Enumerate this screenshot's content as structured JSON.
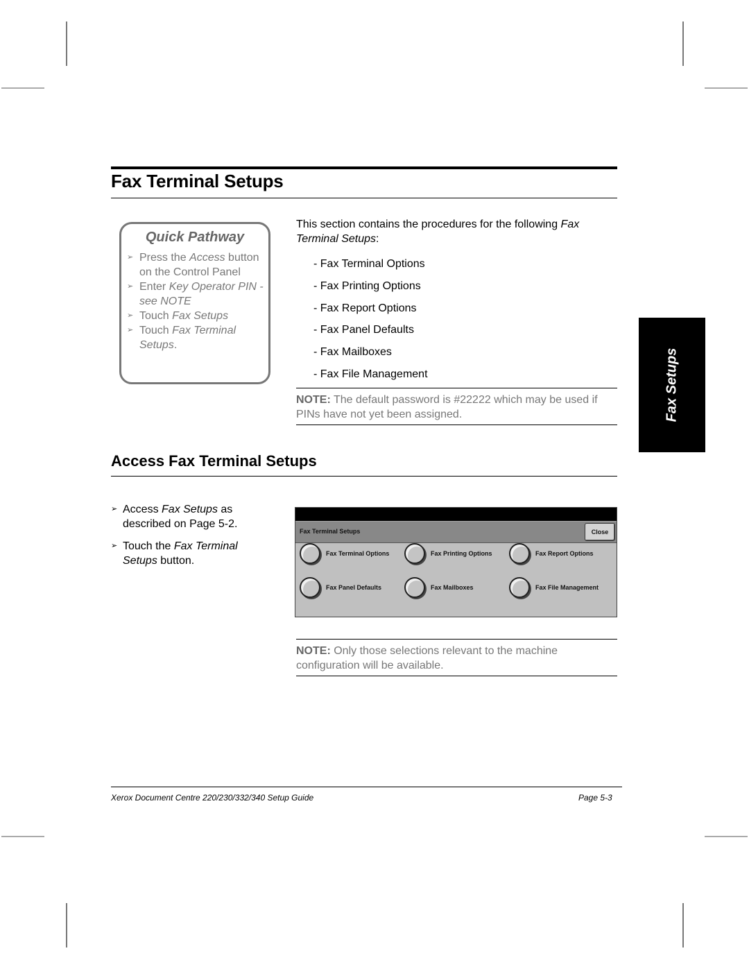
{
  "page_title": "Fax Terminal Setups",
  "quick_pathway": {
    "title": "Quick Pathway",
    "steps": [
      {
        "pre": "Press the ",
        "em": "Access",
        "post": " button on the Control Panel"
      },
      {
        "pre": "Enter ",
        "em": "Key Operator PIN - see NOTE",
        "post": ""
      },
      {
        "pre": "Touch ",
        "em": "Fax Setups",
        "post": ""
      },
      {
        "pre": "Touch ",
        "em": "Fax Terminal Setups",
        "post": "."
      }
    ],
    "bullet": "➢"
  },
  "intro": {
    "pre": "This section contains the procedures for the following ",
    "em": "Fax Terminal Setups",
    "post": ":"
  },
  "procedures": [
    "Fax Terminal Options",
    "Fax Printing Options",
    "Fax Report Options",
    "Fax Panel Defaults",
    "Fax Mailboxes",
    "Fax File Management"
  ],
  "procedure_prefix": "-",
  "note1": {
    "label": "NOTE:",
    "text": " The default password is #22222 which may be used if PINs have not yet been assigned."
  },
  "side_tab": "Fax Setups",
  "section2": {
    "heading": "Access Fax Terminal Setups",
    "steps": [
      {
        "pre": "Access ",
        "em": "Fax Setups",
        "post": " as described on Page 5-2."
      },
      {
        "pre": "Touch the ",
        "em": "Fax Terminal Setups",
        "post": " button."
      }
    ]
  },
  "screen": {
    "bar_title": "Fax Terminal Setups",
    "close_label": "Close",
    "options": [
      "Fax Terminal Options",
      "Fax Printing Options",
      "Fax Report Options",
      "Fax Panel Defaults",
      "Fax Mailboxes",
      "Fax File Management"
    ]
  },
  "note2": {
    "label": "NOTE:",
    "text": " Only those selections relevant to the machine configuration will be available."
  },
  "footer": {
    "left": "Xerox Document Centre 220/230/332/340 Setup Guide",
    "right": "Page 5-3"
  }
}
